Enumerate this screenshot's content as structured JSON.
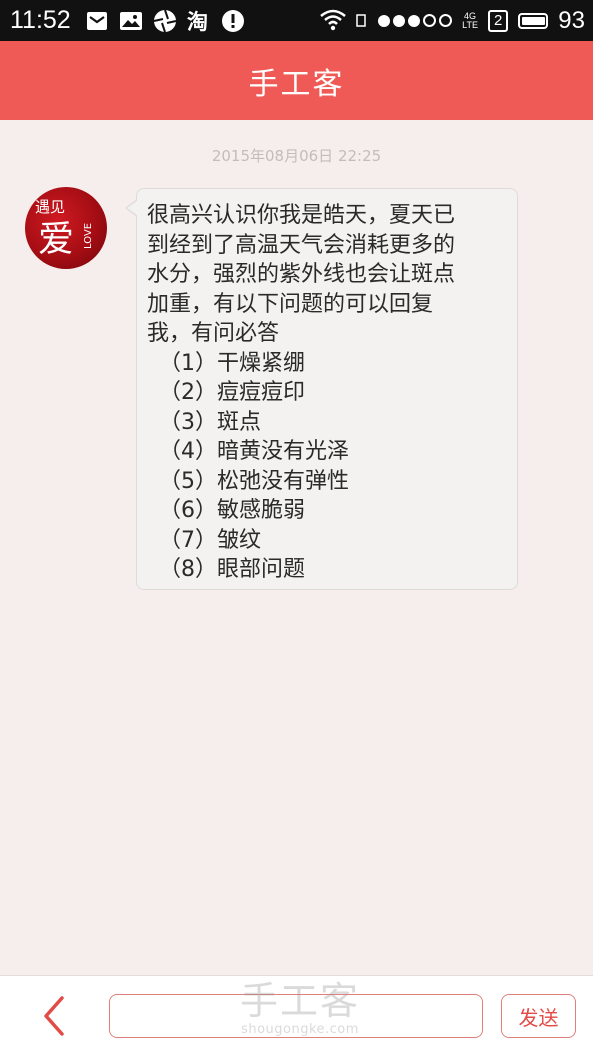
{
  "status_bar": {
    "time": "11:52",
    "icons_left": [
      "mail-icon",
      "image-icon",
      "aperture-icon",
      "taobao-icon",
      "alert-icon"
    ],
    "network": "4G",
    "sim_badge": "2",
    "battery": "93"
  },
  "header": {
    "title": "手工客"
  },
  "chat": {
    "timestamp": "2015年08月06日 22:25",
    "avatar_text": {
      "main": "爱",
      "top": "遇见",
      "side": "LOVE"
    },
    "message": {
      "intro_lines": [
        "很高兴认识你我是皓天，夏天已",
        "到经到了高温天气会消耗更多的",
        "水分，强烈的紫外线也会让斑点",
        "加重，有以下问题的可以回复",
        "我，有问必答"
      ],
      "items": [
        "（1）干燥紧绷",
        "（2）痘痘痘印",
        "（3）斑点",
        "（4）暗黄没有光泽",
        "（5）松弛没有弹性",
        "（6）敏感脆弱",
        "（7）皱纹",
        "（8）眼部问题"
      ]
    }
  },
  "input_bar": {
    "input_value": "",
    "send_label": "发送"
  },
  "watermark": {
    "main": "手工客",
    "sub": "shougongke.com"
  },
  "colors": {
    "accent": "#ef5a56",
    "background": "#f6eeec",
    "bubble": "#f3f2f1"
  }
}
